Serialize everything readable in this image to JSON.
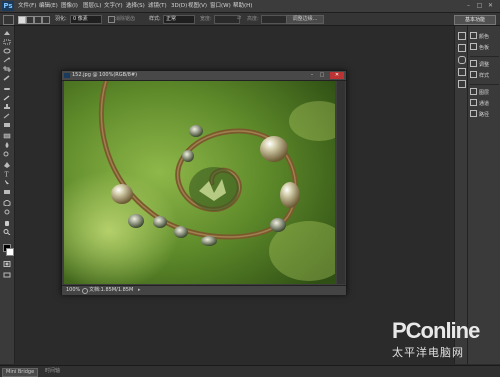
{
  "app": {
    "logo": "Ps"
  },
  "menu": {
    "items": [
      "文件(F)",
      "编辑(E)",
      "图像(I)",
      "图层(L)",
      "文字(Y)",
      "选择(S)",
      "滤镜(T)",
      "3D(D)",
      "视图(V)",
      "窗口(W)",
      "帮助(H)"
    ]
  },
  "window_controls": {
    "minimize": "–",
    "maximize": "□",
    "close": "✕"
  },
  "options_bar": {
    "feather_label": "羽化:",
    "feather_value": "0 像素",
    "antialias_label": "消除锯齿",
    "style_label": "样式:",
    "style_value": "正常",
    "width_label": "宽度:",
    "height_label": "高度:",
    "refine_edge": "调整边缘...",
    "workspace": "基本功能"
  },
  "panels": {
    "items": [
      {
        "label": "颜色",
        "icon": "color-swatch-icon"
      },
      {
        "label": "色板",
        "icon": "swatches-icon"
      },
      {
        "label": "调整",
        "icon": "adjustments-icon"
      },
      {
        "label": "样式",
        "icon": "styles-icon"
      },
      {
        "label": "图层",
        "icon": "layers-icon"
      },
      {
        "label": "通道",
        "icon": "channels-icon"
      },
      {
        "label": "路径",
        "icon": "paths-icon"
      }
    ]
  },
  "document": {
    "title": "152.jpg @ 100%(RGB/8#)",
    "zoom": "100%",
    "info": "文档:1.85M/1.85M"
  },
  "bottom": {
    "mini_bridge": "Mini Bridge",
    "timeline": "时间轴"
  },
  "watermark": {
    "brand": "PConline",
    "sub": "太平洋电脑网"
  },
  "colors": {
    "background": "#2b2b2b",
    "panel": "#3a3a3a",
    "ps_blue": "#7fc4ff"
  }
}
